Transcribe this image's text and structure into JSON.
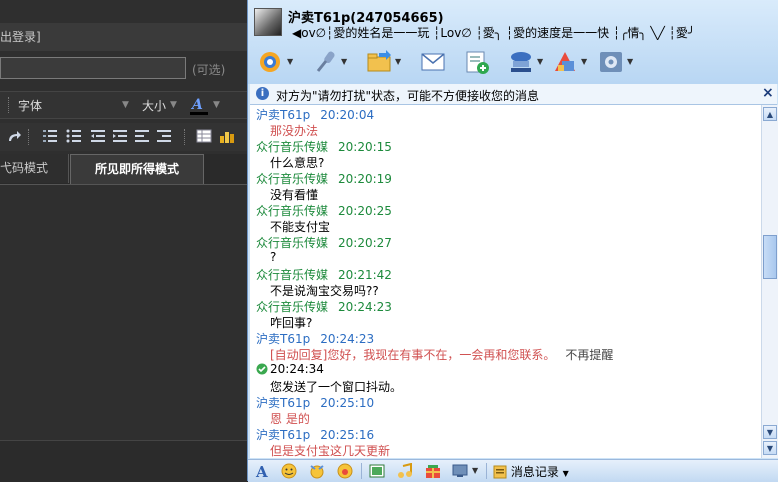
{
  "left": {
    "logout_text": "出登录]",
    "title_placeholder": "",
    "optional_label": "(可选)",
    "font_label": "字体",
    "size_label": "大小",
    "tabs": {
      "code": "弋码模式",
      "wysiwyg": "所见即所得模式"
    }
  },
  "chat": {
    "username": "沪卖T61p(247054665)",
    "signature": "◀ov∅┆愛的姓名是一一玩  ┆Lov∅  ┆愛╮  ┆愛的速度是一一快  ┆╭情╮  ╲╱  ┆愛╯",
    "notice": "对方为\"请勿打扰\"状态，可能不方便接收您的消息",
    "history_label": "消息记录",
    "messages": [
      {
        "kind": "header",
        "sender": "沪卖T61p",
        "time": "20:20:04",
        "side": "other"
      },
      {
        "kind": "body",
        "text": "那没办法",
        "style": "red"
      },
      {
        "kind": "header",
        "sender": "众行音乐传媒",
        "time": "20:20:15",
        "side": "self"
      },
      {
        "kind": "body",
        "text": "什么意思?",
        "style": "black"
      },
      {
        "kind": "header",
        "sender": "众行音乐传媒",
        "time": "20:20:19",
        "side": "self"
      },
      {
        "kind": "body",
        "text": "没有看懂",
        "style": "black"
      },
      {
        "kind": "header",
        "sender": "众行音乐传媒",
        "time": "20:20:25",
        "side": "self"
      },
      {
        "kind": "body",
        "text": "不能支付宝",
        "style": "black"
      },
      {
        "kind": "header",
        "sender": "众行音乐传媒",
        "time": "20:20:27",
        "side": "self"
      },
      {
        "kind": "body",
        "text": "?",
        "style": "black"
      },
      {
        "kind": "header",
        "sender": "众行音乐传媒",
        "time": "20:21:42",
        "side": "self"
      },
      {
        "kind": "body",
        "text": "不是说淘宝交易吗??",
        "style": "black"
      },
      {
        "kind": "header",
        "sender": "众行音乐传媒",
        "time": "20:24:23",
        "side": "self"
      },
      {
        "kind": "body",
        "text": "咋回事?",
        "style": "black"
      },
      {
        "kind": "header",
        "sender": "沪卖T61p",
        "time": "20:24:23",
        "side": "other"
      },
      {
        "kind": "auto",
        "text": "[自动回复]您好，我现在有事不在，一会再和您联系。",
        "extra": "不再提醒"
      },
      {
        "kind": "systime",
        "time": "20:24:34"
      },
      {
        "kind": "body",
        "text": "您发送了一个窗口抖动。",
        "style": "black"
      },
      {
        "kind": "header",
        "sender": "沪卖T61p",
        "time": "20:25:10",
        "side": "other"
      },
      {
        "kind": "body",
        "text": "恩 是的",
        "style": "red"
      },
      {
        "kind": "header",
        "sender": "沪卖T61p",
        "time": "20:25:16",
        "side": "other"
      },
      {
        "kind": "body",
        "text": "但是支付宝这几天更新",
        "style": "red"
      }
    ]
  },
  "colors": {
    "other_sender": "#2c6dc2",
    "self_sender": "#1d8a3c",
    "red_text": "#d05050"
  },
  "icons": [
    "video-call-icon",
    "voice-call-icon",
    "send-file-icon",
    "email-icon",
    "add-app-icon",
    "webcam-icon",
    "remote-assist-icon",
    "settings-icon"
  ]
}
